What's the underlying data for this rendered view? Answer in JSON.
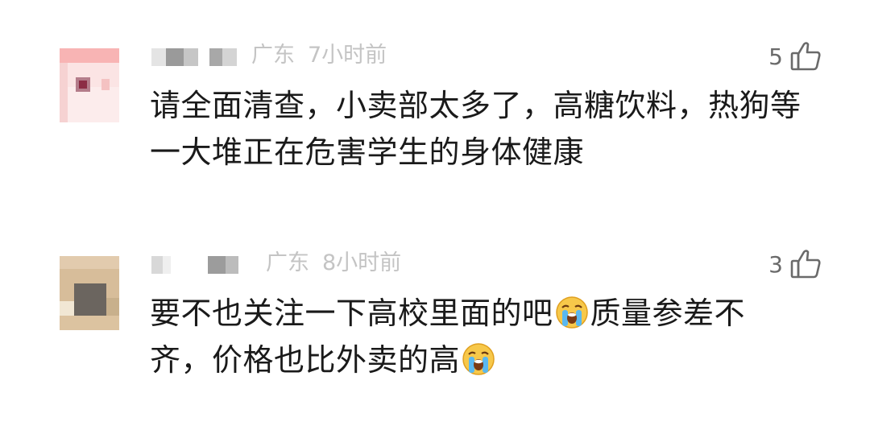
{
  "comments": [
    {
      "location": "广东",
      "time": "7小时前",
      "likes": "5",
      "text": [
        "请全面清查，小卖部太多了，高糖饮料，热狗等",
        "一大堆正在危害学生的身体健康"
      ]
    },
    {
      "location": "广东",
      "time": "8小时前",
      "likes": "3",
      "text_line1_a": "要不也关注一下高校里面的吧",
      "text_line1_b": "质量参差不",
      "text_line2_a": "齐，价格也比外卖的高"
    }
  ],
  "icons": {
    "like": "thumbs-up-outline-icon",
    "emoji": "loudly-crying-face-emoji"
  },
  "colors": {
    "text": "#1a1a1a",
    "meta": "#c4c4c4",
    "likes": "#6a6a6a"
  }
}
